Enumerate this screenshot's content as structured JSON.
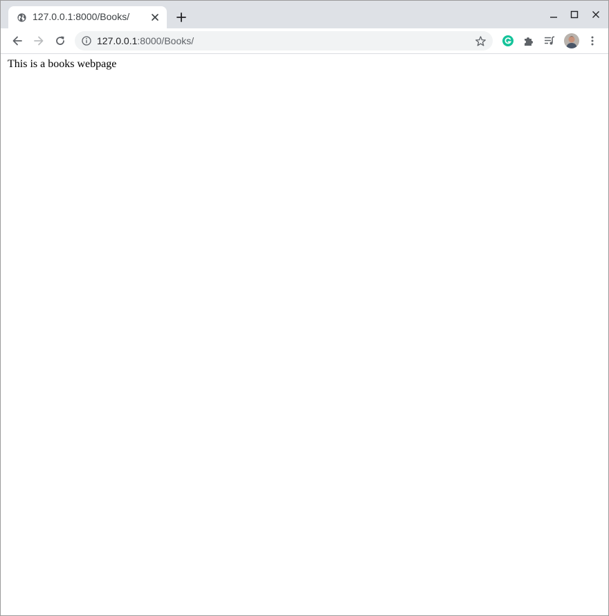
{
  "browser": {
    "tab": {
      "title": "127.0.0.1:8000/Books/",
      "favicon": "globe-icon"
    },
    "toolbar": {
      "url_host": "127.0.0.1",
      "url_rest": ":8000/Books/"
    },
    "extensions": [
      "grammarly-icon",
      "puzzle-extensions-icon",
      "media-controls-icon"
    ],
    "colors": {
      "tabstrip": "#dee1e6",
      "omnibox": "#f1f3f4",
      "grammarly": "#15c39a",
      "icon": "#5f6368"
    }
  },
  "page": {
    "text": "This is a books webpage"
  }
}
